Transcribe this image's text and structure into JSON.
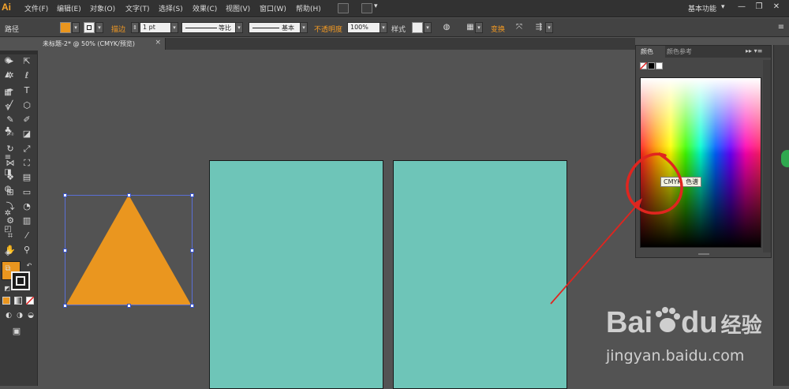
{
  "menubar": {
    "logo": "Ai",
    "items": [
      "文件(F)",
      "编辑(E)",
      "对象(O)",
      "文字(T)",
      "选择(S)",
      "效果(C)",
      "视图(V)",
      "窗口(W)",
      "帮助(H)"
    ],
    "workspace": "基本功能",
    "win_controls": [
      "—",
      "❐",
      "✕"
    ]
  },
  "controlbar": {
    "object_type": "路径",
    "stroke_label": "描边",
    "stroke_weight": "1 pt",
    "stroke_profile": "等比",
    "brush": "基本",
    "opacity_label": "不透明度",
    "opacity_value": "100%",
    "style_label": "样式",
    "transform_label": "变换",
    "fill_color": "#ea961f"
  },
  "document": {
    "tab_title": "未标题-2* @ 50% (CMYK/预览)",
    "close": "×"
  },
  "color_panel": {
    "tabs": [
      "颜色",
      "颜色参考"
    ],
    "tooltip_a": "CMYK",
    "tooltip_b": "色谱",
    "controls": "▸▸ ▾≡"
  },
  "colors": {
    "artboard": "#6ec5b8",
    "triangle": "#ea961f",
    "annotation": "#e0251f"
  },
  "watermark": {
    "brand_a": "Bai",
    "brand_b": "du",
    "brand_cn": "经验",
    "url": "jingyan.baidu.com"
  }
}
